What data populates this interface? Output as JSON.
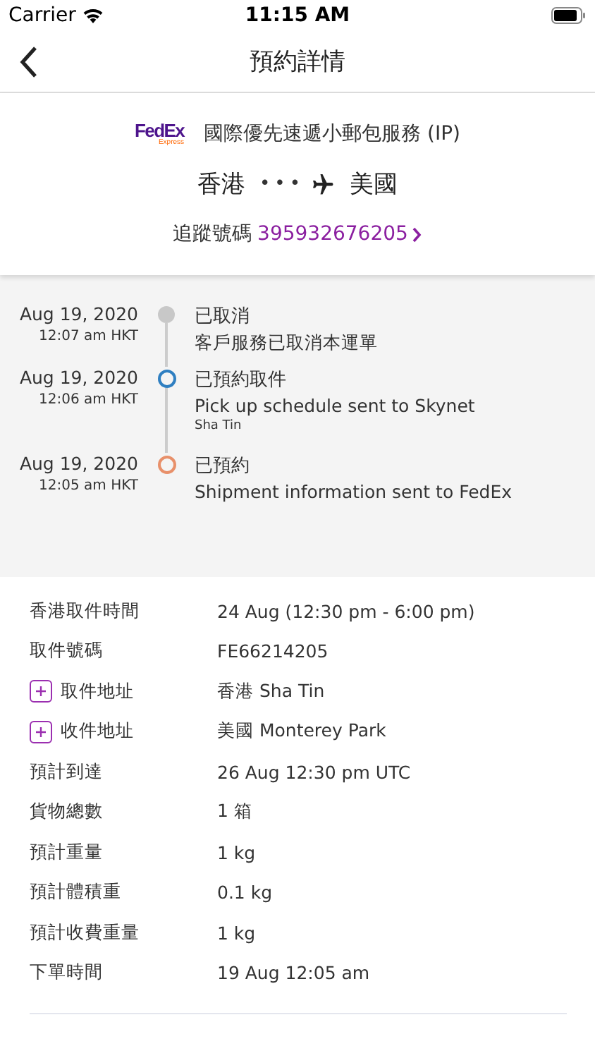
{
  "status_bar": {
    "carrier": "Carrier",
    "time": "11:15 AM"
  },
  "nav": {
    "title": "預約詳情"
  },
  "shipment": {
    "logo": {
      "main": "FedEx",
      "sub": "Express"
    },
    "service": "國際優先速遞小郵包服務 (IP)",
    "origin": "香港",
    "dots": "•••",
    "destination": "美國",
    "tracking_label": "追蹤號碼",
    "tracking_number": "395932676205"
  },
  "timeline": [
    {
      "date": "Aug 19, 2020",
      "time": "12:07 am HKT",
      "status": "已取消",
      "description": "客戶服務已取消本運單",
      "kind": "filled",
      "color": "#c8c8c8"
    },
    {
      "date": "Aug 19, 2020",
      "time": "12:06 am HKT",
      "status": "已預約取件",
      "description": "Pick up schedule sent to Skynet",
      "location": "Sha Tin",
      "kind": "hollow",
      "color": "#2f7fc1"
    },
    {
      "date": "Aug 19, 2020",
      "time": "12:05 am HKT",
      "status": "已預約",
      "description": "Shipment information sent to FedEx",
      "kind": "hollow",
      "color": "#e8906a"
    }
  ],
  "details": [
    {
      "label": "香港取件時間",
      "value": "24 Aug (12:30 pm - 6:00 pm)",
      "expandable": false
    },
    {
      "label": "取件號碼",
      "value": "FE66214205",
      "expandable": false
    },
    {
      "label": "取件地址",
      "value": "香港 Sha Tin",
      "expandable": true
    },
    {
      "label": "收件地址",
      "value": "美國 Monterey Park",
      "expandable": true
    },
    {
      "label": "預計到達",
      "value": "26 Aug 12:30 pm UTC",
      "expandable": false
    },
    {
      "label": "貨物總數",
      "value": "1 箱",
      "expandable": false
    },
    {
      "label": "預計重量",
      "value": "1 kg",
      "expandable": false
    },
    {
      "label": "預計體積重",
      "value": "0.1 kg",
      "expandable": false
    },
    {
      "label": "預計收費重量",
      "value": "1 kg",
      "expandable": false
    },
    {
      "label": "下單時間",
      "value": "19 Aug 12:05 am",
      "expandable": false
    }
  ]
}
